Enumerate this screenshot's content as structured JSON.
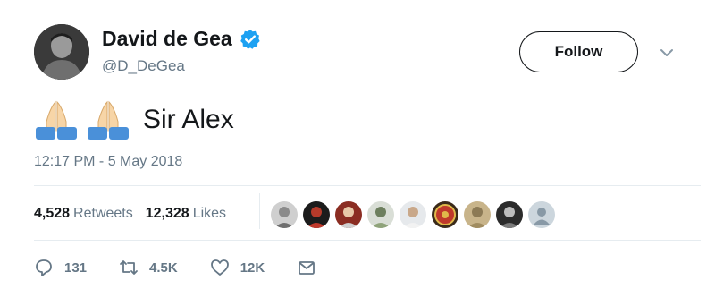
{
  "user": {
    "display_name": "David de Gea",
    "handle": "@D_DeGea",
    "verified": true
  },
  "follow_label": "Follow",
  "tweet": {
    "emojis": [
      "folded-hands-emoji",
      "folded-hands-emoji"
    ],
    "text": "Sir Alex",
    "timestamp": "12:17 PM - 5 May 2018"
  },
  "stats": {
    "retweets_count": "4,528",
    "retweets_label": "Retweets",
    "likes_count": "12,328",
    "likes_label": "Likes"
  },
  "actions": {
    "reply_count": "131",
    "retweet_count": "4.5K",
    "like_count": "12K"
  },
  "colors": {
    "verified_blue": "#1da1f2",
    "secondary_text": "#657786",
    "divider": "#e6ecf0"
  }
}
